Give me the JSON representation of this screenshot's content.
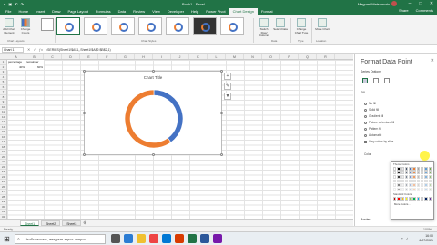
{
  "window": {
    "doc_title": "Book1 - Excel",
    "user": "Megumi Matsumoto"
  },
  "tabs": [
    "File",
    "Home",
    "Insert",
    "Draw",
    "Page Layout",
    "Formulas",
    "Data",
    "Review",
    "View",
    "Developer",
    "Help",
    "Power Pivot",
    "Chart Design",
    "Format"
  ],
  "active_tab": "Chart Design",
  "tabs_right": {
    "share": "Share",
    "comments": "Comments"
  },
  "ribbon": {
    "add_chart_element": "Add Chart Element",
    "quick_layout": "Quick Layout",
    "change_colors": "Change Colors",
    "chart_layouts_group": "Chart Layouts",
    "chart_styles_group": "Chart Styles",
    "switch_row_col": "Switch Row/ Column",
    "select_data": "Select Data",
    "data_group": "Data",
    "change_chart_type": "Change Chart Type",
    "type_group": "Type",
    "move_chart": "Move Chart",
    "location_group": "Location"
  },
  "formula_bar": {
    "name_box": "Chart 1",
    "formula": "=SERIES(Sheet1!$A$1,,Sheet1!$A$2:$B$2,1)"
  },
  "columns": [
    "A",
    "B",
    "C",
    "D",
    "E",
    "F",
    "G",
    "H",
    "I",
    "J",
    "K",
    "L",
    "M",
    "N",
    "O",
    "P",
    "Q",
    "R"
  ],
  "rows": [
    "1",
    "2",
    "3",
    "4",
    "5",
    "6",
    "7",
    "8",
    "9",
    "10",
    "11",
    "12",
    "13",
    "14",
    "15",
    "16",
    "17",
    "18",
    "19",
    "20",
    "21",
    "22",
    "23",
    "24",
    "25",
    "26",
    "27",
    "28",
    "29",
    "30",
    "31",
    "32"
  ],
  "cells": {
    "a1": "percentage",
    "b1": "remainder",
    "a2": "40%",
    "b2": "60%"
  },
  "chart": {
    "title": "Chart Title",
    "series": [
      {
        "value": 40,
        "color": "#4472c4"
      },
      {
        "value": 60,
        "color": "#ed7d31"
      }
    ]
  },
  "sheets": [
    "Sheet1",
    "Sheet2",
    "Sheet3"
  ],
  "active_sheet": "Sheet1",
  "status": {
    "left": "Ready",
    "zoom": "100%"
  },
  "pane": {
    "title": "Format Data Point",
    "subtitle": "Series Options",
    "section": "Fill",
    "options": [
      "No fill",
      "Solid fill",
      "Gradient fill",
      "Picture or texture fill",
      "Pattern fill",
      "Automatic",
      "Vary colors by slice"
    ],
    "color_label": "Color",
    "border": "Border"
  },
  "palette": {
    "theme_label": "Theme Colors",
    "standard_label": "Standard Colors",
    "more": "More Colors..."
  },
  "taskbar": {
    "search": "Чтобы искать, введите здесь запрос",
    "time": "16:00",
    "date": "6/07/2021"
  }
}
